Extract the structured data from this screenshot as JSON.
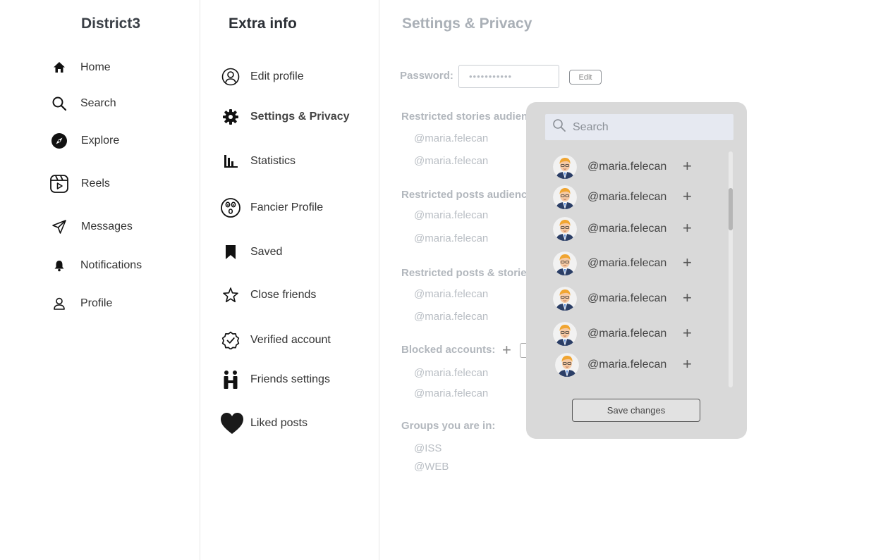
{
  "nav": {
    "brand": "District3",
    "items": [
      {
        "label": "Home",
        "icon": "home-icon"
      },
      {
        "label": "Search",
        "icon": "search-icon"
      },
      {
        "label": "Explore",
        "icon": "compass-icon"
      },
      {
        "label": "Reels",
        "icon": "reels-icon"
      },
      {
        "label": "Messages",
        "icon": "send-icon"
      },
      {
        "label": "Notifications",
        "icon": "bell-icon"
      },
      {
        "label": "Profile",
        "icon": "user-icon"
      }
    ]
  },
  "extra": {
    "title": "Extra info",
    "items": [
      {
        "label": "Edit profile",
        "icon": "user-circle-icon"
      },
      {
        "label": "Settings & Privacy",
        "icon": "gear-icon",
        "active": true
      },
      {
        "label": "Statistics",
        "icon": "bar-chart-icon"
      },
      {
        "label": "Fancier Profile",
        "icon": "surprised-face-icon"
      },
      {
        "label": "Saved",
        "icon": "bookmark-icon"
      },
      {
        "label": "Close friends",
        "icon": "star-icon"
      },
      {
        "label": "Verified account",
        "icon": "verified-badge-icon"
      },
      {
        "label": "Friends settings",
        "icon": "friends-icon"
      },
      {
        "label": "Liked posts",
        "icon": "heart-icon"
      }
    ]
  },
  "settings": {
    "title": "Settings & Privacy",
    "password_label": "Password:",
    "password_value": "•••••••••••",
    "edit_label": "Edit",
    "sections": [
      {
        "title": "Restricted stories audience:",
        "values": [
          "@maria.felecan",
          "@maria.felecan"
        ]
      },
      {
        "title": "Restricted posts audience:",
        "values": [
          "@maria.felecan",
          "@maria.felecan"
        ]
      },
      {
        "title": "Restricted posts & stories:",
        "values": [
          "@maria.felecan",
          "@maria.felecan"
        ]
      },
      {
        "title": "Blocked accounts:",
        "values": [
          "@maria.felecan",
          "@maria.felecan"
        ]
      },
      {
        "title": "Groups you are in:",
        "values": [
          "@ISS",
          "@WEB"
        ]
      }
    ],
    "add_symbol": "+"
  },
  "popup": {
    "search_placeholder": "Search",
    "users": [
      "@maria.felecan",
      "@maria.felecan",
      "@maria.felecan",
      "@maria.felecan",
      "@maria.felecan",
      "@maria.felecan",
      "@maria.felecan"
    ],
    "add_symbol": "+",
    "save_label": "Save changes"
  }
}
